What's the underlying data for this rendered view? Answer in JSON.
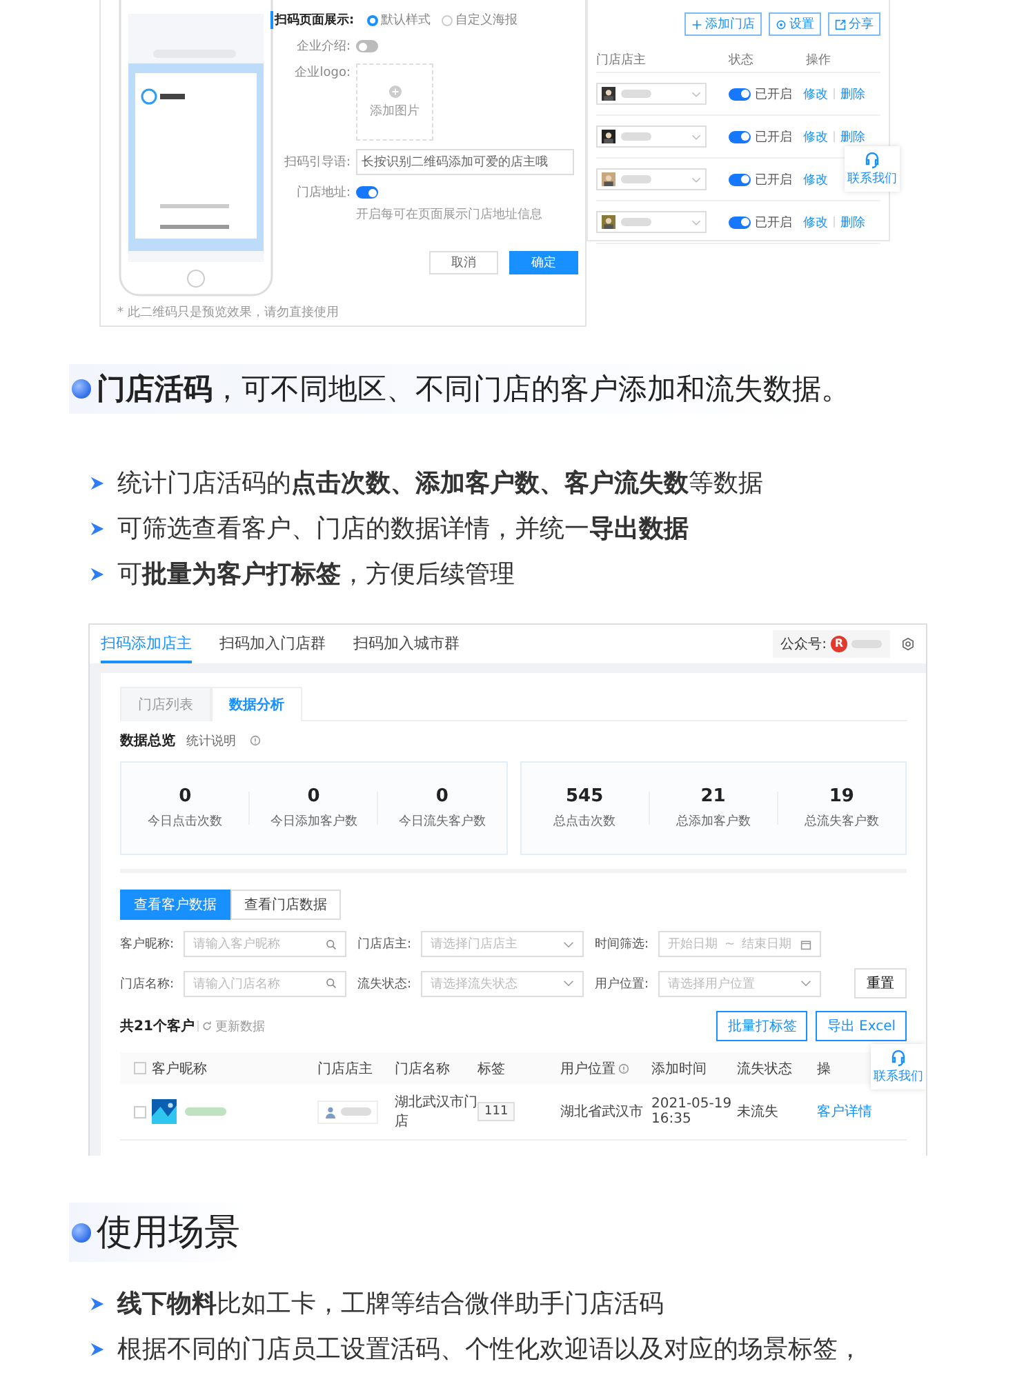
{
  "preview": {
    "form": {
      "display_label": "扫码页面展示:",
      "radios": [
        {
          "label": "默认样式",
          "selected": true
        },
        {
          "label": "自定义海报",
          "selected": false
        }
      ],
      "intro_label": "企业介绍:",
      "intro_on": false,
      "logo_label": "企业logo:",
      "upload_text": "添加图片",
      "guide_label": "扫码引导语:",
      "guide_value": "长按识别二维码添加可爱的店主哦",
      "address_label": "门店地址:",
      "address_on": true,
      "address_hint": "开启每可在页面展示门店地址信息",
      "buttons": [
        {
          "label": "取消",
          "primary": false
        },
        {
          "label": "确定",
          "primary": true
        }
      ]
    },
    "note": "* 此二维码只是预览效果，请勿直接使用"
  },
  "store_panel": {
    "buttons": [
      "添加门店",
      "设置",
      "分享"
    ],
    "columns": [
      "门店店主",
      "状态",
      "操作"
    ],
    "rows": [
      {
        "on": true,
        "status": "已开启",
        "actions": [
          "修改",
          "删除"
        ]
      },
      {
        "on": true,
        "status": "已开启",
        "actions": [
          "修改",
          "删除"
        ]
      },
      {
        "on": true,
        "status": "已开启",
        "actions": [
          "修改"
        ]
      },
      {
        "on": true,
        "status": "已开启",
        "actions": [
          "修改",
          "删除"
        ]
      }
    ],
    "contact": "联系我们"
  },
  "section_1": {
    "heading": "**门店活码**，可不同地区、不同门店的客户添加和流失数据。",
    "bullets": [
      "统计门店活码的**点击次数、添加客户数、客户流失数**等数据",
      "可筛选查看客户、门店的数据详情，并统一**导出数据**",
      "可**批量为客户打标签**，方便后续管理"
    ]
  },
  "dashboard": {
    "tabs": [
      {
        "label": "扫码添加店主",
        "selected": true
      },
      {
        "label": "扫码加入门店群",
        "selected": false
      },
      {
        "label": "扫码加入城市群",
        "selected": false
      }
    ],
    "account_label": "公众号:",
    "account_avatar": "R",
    "subtabs": [
      {
        "label": "门店列表",
        "selected": false
      },
      {
        "label": "数据分析",
        "selected": true
      }
    ],
    "overview_title": "数据总览",
    "overview_help": "统计说明",
    "stat_groups": [
      [
        {
          "value": "0",
          "label": "今日点击次数"
        },
        {
          "value": "0",
          "label": "今日添加客户数"
        },
        {
          "value": "0",
          "label": "今日流失客户数"
        }
      ],
      [
        {
          "value": "545",
          "label": "总点击次数"
        },
        {
          "value": "21",
          "label": "总添加客户数"
        },
        {
          "value": "19",
          "label": "总流失客户数"
        }
      ]
    ],
    "views": [
      {
        "label": "查看客户数据",
        "selected": true
      },
      {
        "label": "查看门店数据",
        "selected": false
      }
    ],
    "filters": [
      {
        "kind": "search",
        "label": "客户昵称:",
        "placeholder": "请输入客户昵称"
      },
      {
        "kind": "select",
        "label": "门店店主:",
        "placeholder": "请选择门店店主"
      },
      {
        "kind": "date",
        "label": "时间筛选:",
        "start": "开始日期",
        "sep": "~",
        "end": "结束日期"
      },
      {
        "kind": "search",
        "label": "门店名称:",
        "placeholder": "请输入门店名称"
      },
      {
        "kind": "select",
        "label": "流失状态:",
        "placeholder": "请选择流失状态"
      },
      {
        "kind": "select",
        "label": "用户位置:",
        "placeholder": "请选择用户位置"
      }
    ],
    "reset": "重置",
    "count": "共21个客户",
    "refresh": "更新数据",
    "actions": [
      "批量打标签",
      "导出 Excel"
    ],
    "all_checked": false,
    "columns": [
      {
        "label": "客户昵称",
        "help": false
      },
      {
        "label": "门店店主",
        "help": false
      },
      {
        "label": "门店名称",
        "help": false
      },
      {
        "label": "标签",
        "help": false
      },
      {
        "label": "用户位置",
        "help": true
      },
      {
        "label": "添加时间",
        "help": false
      },
      {
        "label": "流失状态",
        "help": false
      },
      {
        "label": "操",
        "help": false
      }
    ],
    "rows": [
      {
        "store": "湖北武汉市门店",
        "tag": "111",
        "location": "湖北省武汉市",
        "time": "2021-05-19 16:35",
        "status": "未流失",
        "action": "客户详情",
        "checked": false
      }
    ],
    "contact": "联系我们"
  },
  "section_2": {
    "heading": "使用场景",
    "bullets": [
      "**线下物料**比如工卡，工牌等结合微伴助手门店活码",
      "根据不同的门店员工设置活码、个性化欢迎语以及对应的场景标签，"
    ]
  }
}
